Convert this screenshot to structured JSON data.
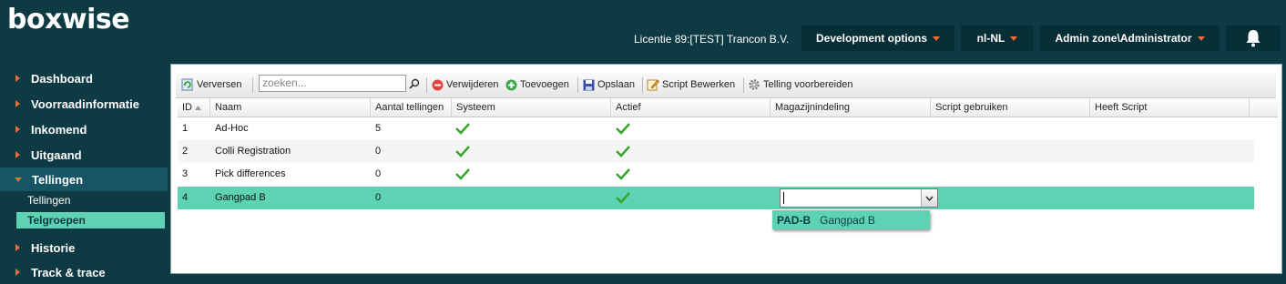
{
  "header": {
    "logo": "boxwise",
    "license": "Licentie 89:[TEST] Trancon B.V.",
    "dev_options": "Development options",
    "language": "nl-NL",
    "user": "Admin zone\\Administrator",
    "bell_icon": "bell-icon"
  },
  "sidebar": {
    "items": [
      {
        "label": "Dashboard"
      },
      {
        "label": "Voorraadinformatie"
      },
      {
        "label": "Inkomend"
      },
      {
        "label": "Uitgaand"
      },
      {
        "label": "Tellingen"
      },
      {
        "label": "Historie"
      },
      {
        "label": "Track & trace"
      }
    ],
    "subitems": [
      {
        "label": "Tellingen"
      },
      {
        "label": "Telgroepen"
      }
    ]
  },
  "toolbar": {
    "refresh": "Verversen",
    "search_placeholder": "zoeken...",
    "delete": "Verwijderen",
    "add": "Toevoegen",
    "save": "Opslaan",
    "edit_script": "Script Bewerken",
    "prepare": "Telling voorbereiden"
  },
  "grid": {
    "columns": [
      "ID",
      "Naam",
      "Aantal tellingen",
      "Systeem",
      "Actief",
      "Magazijnindeling",
      "Script gebruiken",
      "Heeft Script"
    ],
    "rows": [
      {
        "id": "1",
        "naam": "Ad-Hoc",
        "aantal": "5",
        "systeem": true,
        "actief": true
      },
      {
        "id": "2",
        "naam": "Colli Registration",
        "aantal": "0",
        "systeem": true,
        "actief": true
      },
      {
        "id": "3",
        "naam": "Pick differences",
        "aantal": "0",
        "systeem": true,
        "actief": true
      },
      {
        "id": "4",
        "naam": "Gangpad B",
        "aantal": "0",
        "systeem": false,
        "actief": true
      }
    ]
  },
  "dropdown": {
    "code": "PAD-B",
    "name": "Gangpad B"
  },
  "colors": {
    "header_bg": "#0e3a44",
    "accent": "#f26b3a",
    "selection": "#5dd3b3",
    "check": "#3aa52e"
  }
}
